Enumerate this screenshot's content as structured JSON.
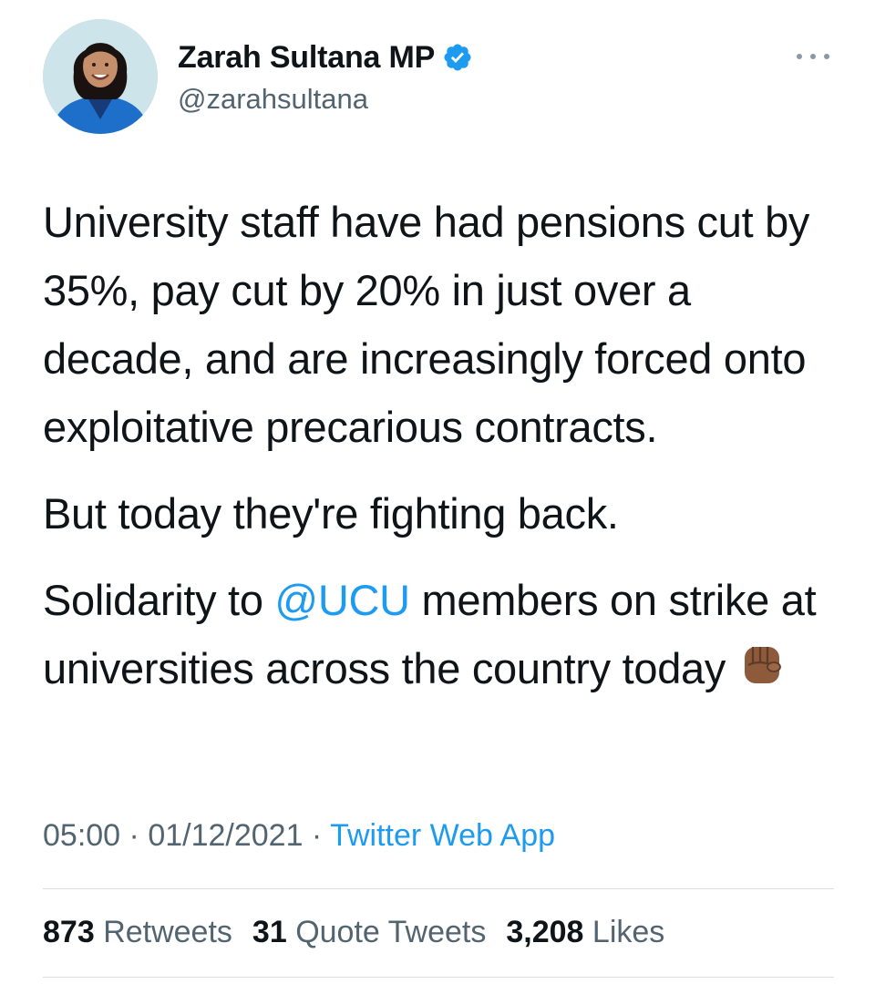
{
  "author": {
    "display_name": "Zarah Sultana MP",
    "handle": "@zarahsultana",
    "verified": true,
    "avatar_icon": "profile-photo"
  },
  "more_icon": "more-horizontal-icon",
  "tweet": {
    "para1": "University staff have had pensions cut by 35%, pay cut by 20% in just over a decade, and are increasingly forced onto exploitative precarious contracts.",
    "para2": "But today they're fighting back.",
    "para3_before": "Solidarity to ",
    "para3_mention": "@UCU",
    "para3_after": " members on strike at universities across the country today",
    "emoji": "raised-fist-emoji"
  },
  "meta": {
    "time": "05:00",
    "sep1": " · ",
    "date": "01/12/2021",
    "sep2": " · ",
    "app": "Twitter Web App"
  },
  "stats": {
    "retweets_count": "873",
    "retweets_label": "Retweets",
    "quotes_count": "31",
    "quotes_label": "Quote Tweets",
    "likes_count": "3,208",
    "likes_label": "Likes"
  },
  "colors": {
    "link": "#1d9bf0",
    "text": "#0f1419",
    "secondary": "#536471",
    "divider": "#d9dde1"
  }
}
